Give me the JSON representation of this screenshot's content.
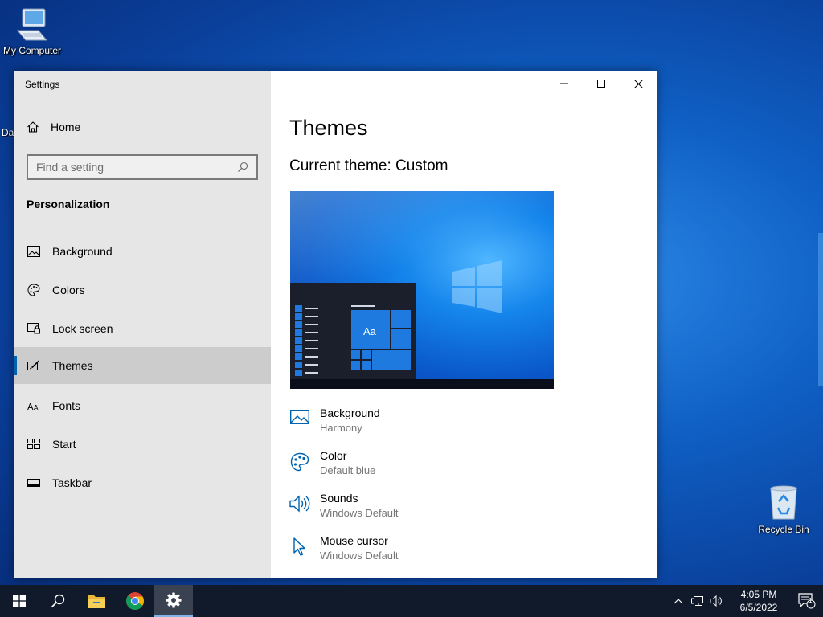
{
  "desktop": {
    "icons": [
      {
        "label": "My Computer",
        "icon": "computer-icon"
      },
      {
        "label": "Recycle Bin",
        "icon": "recycle-bin-icon"
      }
    ],
    "partial_label": "Da"
  },
  "window": {
    "title": "Settings",
    "controls": [
      "minimize",
      "maximize",
      "close"
    ]
  },
  "sidebar": {
    "home_label": "Home",
    "search_placeholder": "Find a setting",
    "section_title": "Personalization",
    "items": [
      {
        "label": "Background",
        "icon": "picture-icon"
      },
      {
        "label": "Colors",
        "icon": "palette-icon"
      },
      {
        "label": "Lock screen",
        "icon": "lock-screen-icon"
      },
      {
        "label": "Themes",
        "icon": "brush-icon",
        "active": true
      },
      {
        "label": "Fonts",
        "icon": "font-icon"
      },
      {
        "label": "Start",
        "icon": "start-icon"
      },
      {
        "label": "Taskbar",
        "icon": "taskbar-icon"
      }
    ]
  },
  "main": {
    "title": "Themes",
    "current_theme": "Current theme: Custom",
    "preview_tile_text": "Aa",
    "theme_items": [
      {
        "name": "Background",
        "value": "Harmony",
        "icon": "picture-icon"
      },
      {
        "name": "Color",
        "value": "Default blue",
        "icon": "palette-icon"
      },
      {
        "name": "Sounds",
        "value": "Windows Default",
        "icon": "speaker-icon"
      },
      {
        "name": "Mouse cursor",
        "value": "Windows Default",
        "icon": "cursor-icon"
      }
    ]
  },
  "taskbar": {
    "apps": [
      "start-icon",
      "search-icon",
      "file-explorer-icon",
      "chrome-icon",
      "settings-icon"
    ],
    "time": "4:05 PM",
    "date": "6/5/2022",
    "notification_count": "1",
    "accent": "#0063b1"
  }
}
